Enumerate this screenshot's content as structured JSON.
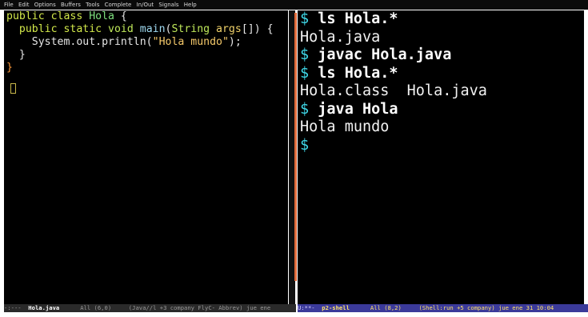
{
  "menu": {
    "items": [
      "File",
      "Edit",
      "Options",
      "Buffers",
      "Tools",
      "Complete",
      "In/Out",
      "Signals",
      "Help"
    ]
  },
  "editor": {
    "lines": [
      [
        {
          "t": "public class ",
          "c": "kw"
        },
        {
          "t": "Hola",
          "c": "cls"
        },
        {
          "t": " {",
          "c": "brace"
        }
      ],
      [
        {
          "t": "  public static ",
          "c": "kw"
        },
        {
          "t": "void ",
          "c": "ty"
        },
        {
          "t": "main",
          "c": "fn"
        },
        {
          "t": "(",
          "c": "brace"
        },
        {
          "t": "String ",
          "c": "ty"
        },
        {
          "t": "args",
          "c": "var"
        },
        {
          "t": "[]) {",
          "c": "brace"
        }
      ],
      [
        {
          "t": "    System.out.println(",
          "c": "brace"
        },
        {
          "t": "\"Hola mundo\"",
          "c": "st"
        },
        {
          "t": ");",
          "c": "brace"
        }
      ],
      [
        {
          "t": "  }",
          "c": "brace"
        }
      ],
      [
        {
          "t": "}",
          "c": "bracehl"
        }
      ]
    ]
  },
  "shell": {
    "lines": [
      [
        {
          "t": "$ ",
          "c": "prompt"
        },
        {
          "t": "ls Hola.*",
          "c": "cmd"
        }
      ],
      [
        {
          "t": "Hola.java",
          "c": ""
        }
      ],
      [
        {
          "t": "$ ",
          "c": "prompt"
        },
        {
          "t": "javac Hola.java",
          "c": "cmd"
        }
      ],
      [
        {
          "t": "$ ",
          "c": "prompt"
        },
        {
          "t": "ls Hola.*",
          "c": "cmd"
        }
      ],
      [
        {
          "t": "Hola.class  Hola.java",
          "c": ""
        }
      ],
      [
        {
          "t": "$ ",
          "c": "prompt"
        },
        {
          "t": "java Hola",
          "c": "cmd"
        }
      ],
      [
        {
          "t": "Hola mundo",
          "c": ""
        }
      ],
      [
        {
          "t": "$",
          "c": "prompt"
        }
      ]
    ]
  },
  "modeline_left": {
    "status": "-:---  ",
    "buffer": "Hola.java",
    "position": "      All (6,0)     ",
    "modes": "(Java//l +3 company FlyC- Abbrev) jue ene"
  },
  "modeline_right": {
    "status": "U:**-  ",
    "buffer": "p2-shell",
    "position": "      All (8,2)     ",
    "modes": "(Shell:run +5 company) jue ene 31 10:04"
  },
  "colors": {
    "background": "#000000",
    "prompt": "#3fd8e8",
    "keyword": "#d2e84a",
    "string": "#f5c96a",
    "modeline_active": "#3b3a9a",
    "modeline_inactive": "#2a2a2a",
    "scroll_thumb": "#e06a3a"
  }
}
